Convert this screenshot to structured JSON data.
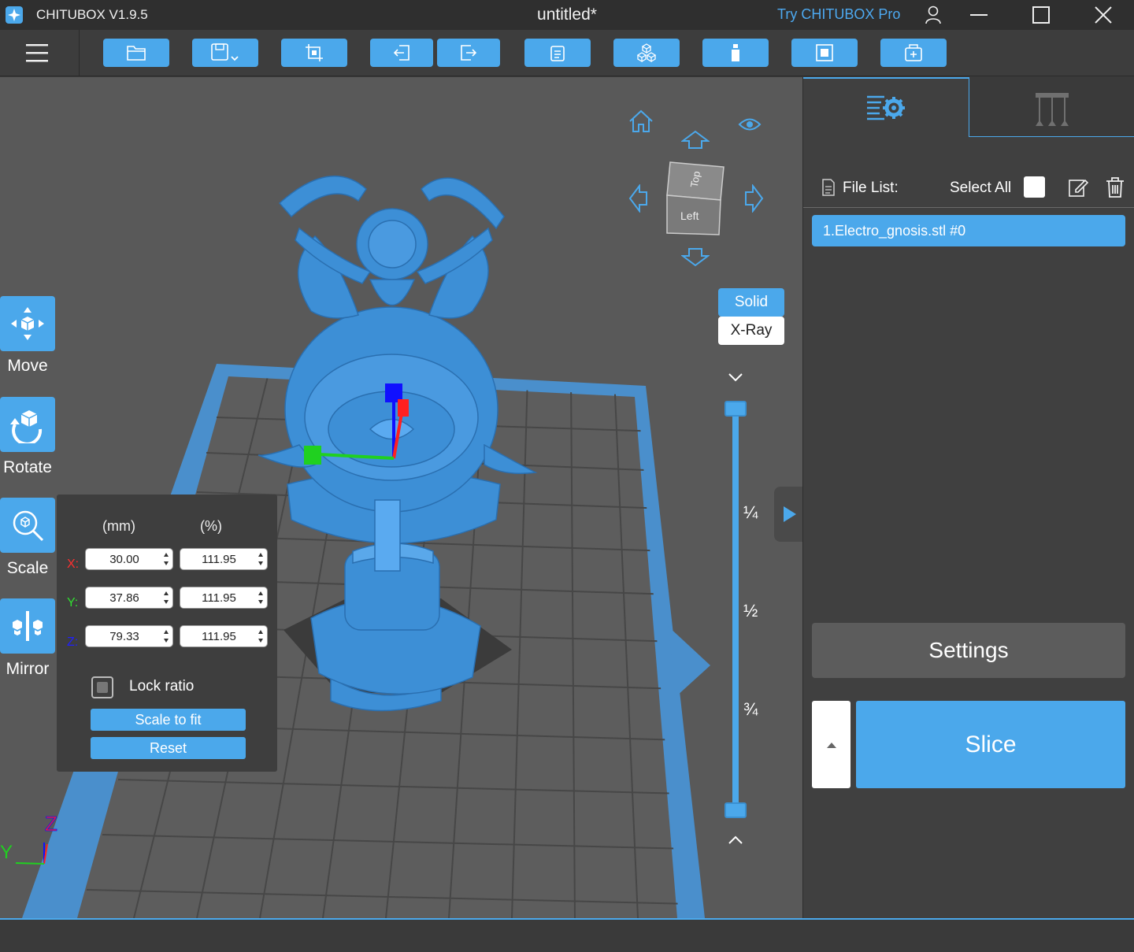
{
  "titlebar": {
    "app_title": "CHITUBOX V1.9.5",
    "doc_title": "untitled*",
    "try_pro": "Try CHITUBOX Pro"
  },
  "toolbar": {
    "buttons": [
      "open-file-icon",
      "save-icon",
      "crop-icon",
      "import-icon",
      "export-icon",
      "pages-icon",
      "cubes-icon",
      "bottle-icon",
      "square-icon",
      "add-box-icon"
    ]
  },
  "tools": {
    "move": "Move",
    "rotate": "Rotate",
    "scale": "Scale",
    "mirror": "Mirror"
  },
  "scale_panel": {
    "header_mm": "(mm)",
    "header_pct": "(%)",
    "x_label": "X:",
    "y_label": "Y:",
    "z_label": "Z:",
    "x_mm": "30.00",
    "x_pct": "111.95",
    "y_mm": "37.86",
    "y_pct": "111.95",
    "z_mm": "79.33",
    "z_pct": "111.95",
    "lock_ratio": "Lock ratio",
    "lock_ratio_checked": false,
    "scale_to_fit": "Scale to fit",
    "reset": "Reset"
  },
  "view": {
    "cube_top": "Top",
    "cube_left": "Left",
    "solid": "Solid",
    "xray": "X-Ray",
    "active_mode": "Solid"
  },
  "slider": {
    "quarter": "¼",
    "half": "½",
    "three_quarter": "¾"
  },
  "axes": {
    "y": "Y",
    "z": "Z"
  },
  "right_panel": {
    "file_list_label": "File List:",
    "select_all": "Select All",
    "files": [
      "1.Electro_gnosis.stl #0"
    ],
    "settings": "Settings",
    "slice": "Slice"
  },
  "colors": {
    "accent": "#4ba8eb",
    "model": "#3d8fd6",
    "x_axis": "#ff2020",
    "y_axis": "#20d020",
    "z_axis": "#1010ff"
  }
}
